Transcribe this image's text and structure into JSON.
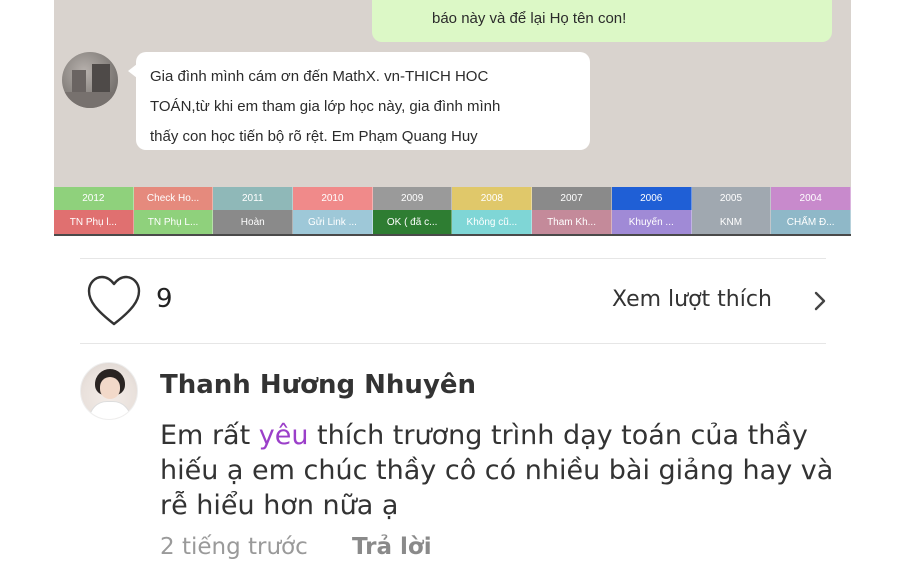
{
  "chat": {
    "outgoing_text": "báo này và để lại Họ tên con!",
    "incoming_lines": [
      "Gia đình mình cám ơn đến MathX. vn-THICH HOC",
      "TOÁN,từ khi em tham gia lớp học này, gia đình mình",
      "thấy con học tiến bộ rõ rệt. Em Phạm Quang Huy"
    ],
    "tags_row1": [
      {
        "label": "2012",
        "color": "#8fd17c"
      },
      {
        "label": "Check Ho...",
        "color": "#e58a7d"
      },
      {
        "label": "2011",
        "color": "#8fb8b8"
      },
      {
        "label": "2010",
        "color": "#f08a8a"
      },
      {
        "label": "2009",
        "color": "#9a9a9a"
      },
      {
        "label": "2008",
        "color": "#e0c86a"
      },
      {
        "label": "2007",
        "color": "#8a8a8a"
      },
      {
        "label": "2006",
        "color": "#1f5fd6"
      },
      {
        "label": "2005",
        "color": "#a0a8b0"
      },
      {
        "label": "2004",
        "color": "#c88acc"
      }
    ],
    "tags_row2": [
      {
        "label": "TN Phụ l...",
        "color": "#e07070"
      },
      {
        "label": "TN Phụ L...",
        "color": "#8fd17c"
      },
      {
        "label": "Hoàn",
        "color": "#8a8a8a"
      },
      {
        "label": "Gửi Link ...",
        "color": "#9ec8d8"
      },
      {
        "label": "OK ( đã c...",
        "color": "#2e7d32"
      },
      {
        "label": "Không cũ...",
        "color": "#7fd6d6"
      },
      {
        "label": "Tham Kh...",
        "color": "#c48a9a"
      },
      {
        "label": "Khuyến ...",
        "color": "#a08ad6"
      },
      {
        "label": "KNM",
        "color": "#a0a8b0"
      },
      {
        "label": "CHẤM Đ...",
        "color": "#8fb8c8"
      }
    ]
  },
  "likes": {
    "count": "9",
    "see_likes_label": "Xem lượt thích"
  },
  "comment": {
    "author": "Thanh Hương Nhuyên",
    "text_before": "Em rất ",
    "text_highlight": "yêu",
    "text_after": " thích trương trình dạy toán của thầy hiếu ạ em chúc thầy cô có nhiều bài giảng hay và rễ hiểu hơn nữa ạ",
    "time": "2 tiếng trước",
    "reply_label": "Trả lời"
  },
  "colors": {
    "highlight": "#9b3fc9",
    "chat_bg": "#d9d3ce",
    "outgoing_bubble": "#dcf8c6"
  }
}
